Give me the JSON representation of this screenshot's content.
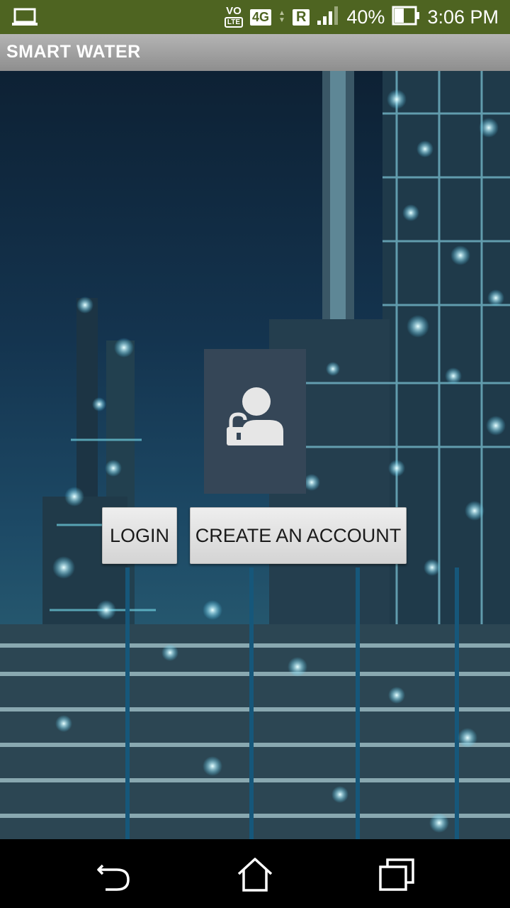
{
  "status_bar": {
    "left_icon": "laptop-icon",
    "volte_top": "VO",
    "volte_bottom": "LTE",
    "network": "4G",
    "roaming": "R",
    "battery": "40%",
    "time": "3:06 PM"
  },
  "app_bar": {
    "title": "SMART WATER"
  },
  "main": {
    "center_icon": "user-lock-icon",
    "login_label": "LOGIN",
    "create_account_label": "CREATE AN ACCOUNT"
  },
  "nav_bar": {
    "back_icon": "back-icon",
    "home_icon": "home-icon",
    "recents_icon": "recents-icon"
  },
  "colors": {
    "status_bar": "#4e6421",
    "tile": "#354657",
    "button": "#e3e3e3"
  }
}
